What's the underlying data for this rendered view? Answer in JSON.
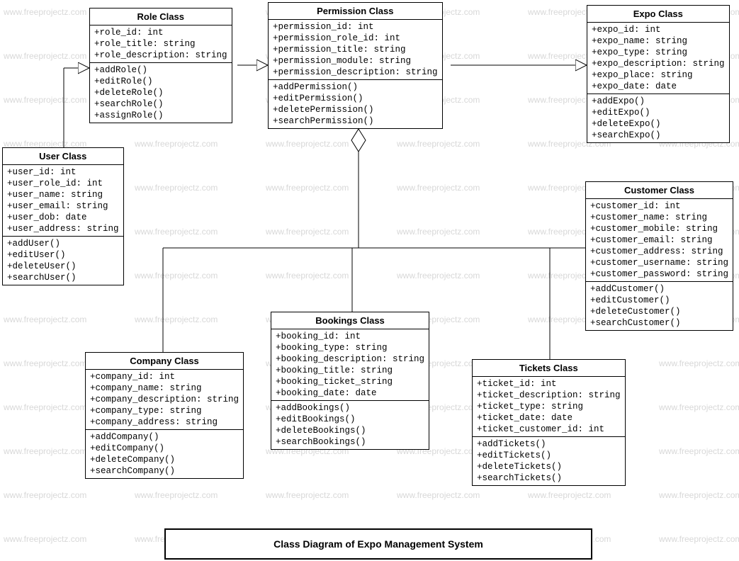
{
  "watermark_text": "www.freeprojectz.com",
  "caption": "Class Diagram of Expo Management System",
  "classes": {
    "role": {
      "title": "Role Class",
      "attrs": [
        "+role_id: int",
        "+role_title: string",
        "+role_description: string"
      ],
      "ops": [
        "+addRole()",
        "+editRole()",
        "+deleteRole()",
        "+searchRole()",
        "+assignRole()"
      ]
    },
    "permission": {
      "title": "Permission Class",
      "attrs": [
        "+permission_id: int",
        "+permission_role_id: int",
        "+permission_title: string",
        "+permission_module: string",
        "+permission_description: string"
      ],
      "ops": [
        "+addPermission()",
        "+editPermission()",
        "+deletePermission()",
        "+searchPermission()"
      ]
    },
    "expo": {
      "title": "Expo Class",
      "attrs": [
        "+expo_id: int",
        "+expo_name: string",
        "+expo_type: string",
        "+expo_description: string",
        "+expo_place: string",
        "+expo_date: date"
      ],
      "ops": [
        "+addExpo()",
        "+editExpo()",
        "+deleteExpo()",
        "+searchExpo()"
      ]
    },
    "user": {
      "title": "User Class",
      "attrs": [
        "+user_id: int",
        "+user_role_id: int",
        "+user_name: string",
        "+user_email: string",
        "+user_dob: date",
        "+user_address: string"
      ],
      "ops": [
        "+addUser()",
        "+editUser()",
        "+deleteUser()",
        "+searchUser()"
      ]
    },
    "customer": {
      "title": "Customer Class",
      "attrs": [
        "+customer_id: int",
        "+customer_name: string",
        "+customer_mobile: string",
        "+customer_email: string",
        "+customer_address: string",
        "+customer_username: string",
        "+customer_password: string"
      ],
      "ops": [
        "+addCustomer()",
        "+editCustomer()",
        "+deleteCustomer()",
        "+searchCustomer()"
      ]
    },
    "bookings": {
      "title": "Bookings Class",
      "attrs": [
        "+booking_id: int",
        "+booking_type: string",
        "+booking_description: string",
        "+booking_title: string",
        "+booking_ticket_string",
        "+booking_date: date"
      ],
      "ops": [
        "+addBookings()",
        "+editBookings()",
        "+deleteBookings()",
        "+searchBookings()"
      ]
    },
    "company": {
      "title": "Company Class",
      "attrs": [
        "+company_id: int",
        "+company_name: string",
        "+company_description: string",
        "+company_type: string",
        "+company_address: string"
      ],
      "ops": [
        "+addCompany()",
        "+editCompany()",
        "+deleteCompany()",
        "+searchCompany()"
      ]
    },
    "tickets": {
      "title": "Tickets Class",
      "attrs": [
        "+ticket_id: int",
        "+ticket_description: string",
        "+ticket_type: string",
        "+ticket_date: date",
        "+ticket_customer_id: int"
      ],
      "ops": [
        "+addTickets()",
        "+editTickets()",
        "+deleteTickets()",
        "+searchTickets()"
      ]
    }
  }
}
